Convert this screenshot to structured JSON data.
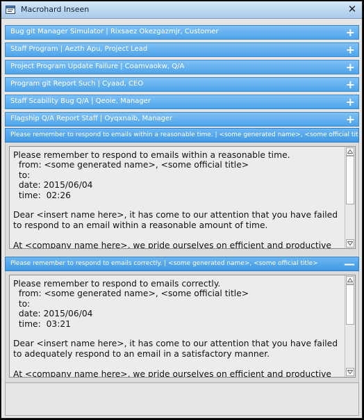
{
  "window": {
    "title": "Macrohard Inseen",
    "close_glyph": "✕",
    "icon": "app-window-icon"
  },
  "collapsed_items": [
    {
      "label": "Bug git Manager Simulator | Rixsaez Okezgazmjr, Customer",
      "sign": "+"
    },
    {
      "label": "Staff Program | Aezth Apu, Project Lead",
      "sign": "+"
    },
    {
      "label": "Project Program Update Failure | Coamvaokw, Q/A",
      "sign": "+"
    },
    {
      "label": "Program git Report Such | Cyaad, CEO",
      "sign": "+"
    },
    {
      "label": "Staff Scability Bug Q/A | Qeoie, Manager",
      "sign": "+"
    },
    {
      "label": "Flagship Q/A Report Staff | Oyqxnaib, Manager",
      "sign": "+"
    }
  ],
  "expanded_items": [
    {
      "label": "Please remember to respond to emails within a reasonable time. | <some generated name>, <some official title>",
      "sign": "",
      "body": "Please remember to respond to emails within a reasonable time.\n  from: <some generated name>, <some official title>\n  to:\n  date: 2015/06/04\n  time:  02:26\n\nDear <insert name here>, it has come to our attention that you have failed to respond to an email within a reasonable amount of time.\n\nAt <company name here>, we pride ourselves on efficient and productive work at all times. Please respond to all emails with a reasonable time in the future."
    },
    {
      "label": "Please remember to respond to emails correctly. | <some generated name>, <some official title>",
      "sign": "—",
      "body": "Please remember to respond to emails correctly.\n  from: <some generated name>, <some official title>\n  to:\n  date: 2015/06/04\n  time:  03:21\n\nDear <insert name here>, it has come to our attention that you have failed to adequately respond to an email in a satisfactory manner.\n\nAt <company name here>, we pride ourselves on efficient and productive work at all times. Please respond to all emails with a reasonable time in the future."
    }
  ],
  "colors": {
    "header_blue": "#4ea4ea",
    "header_text": "#ffffff",
    "background": "#e6e6e6"
  }
}
